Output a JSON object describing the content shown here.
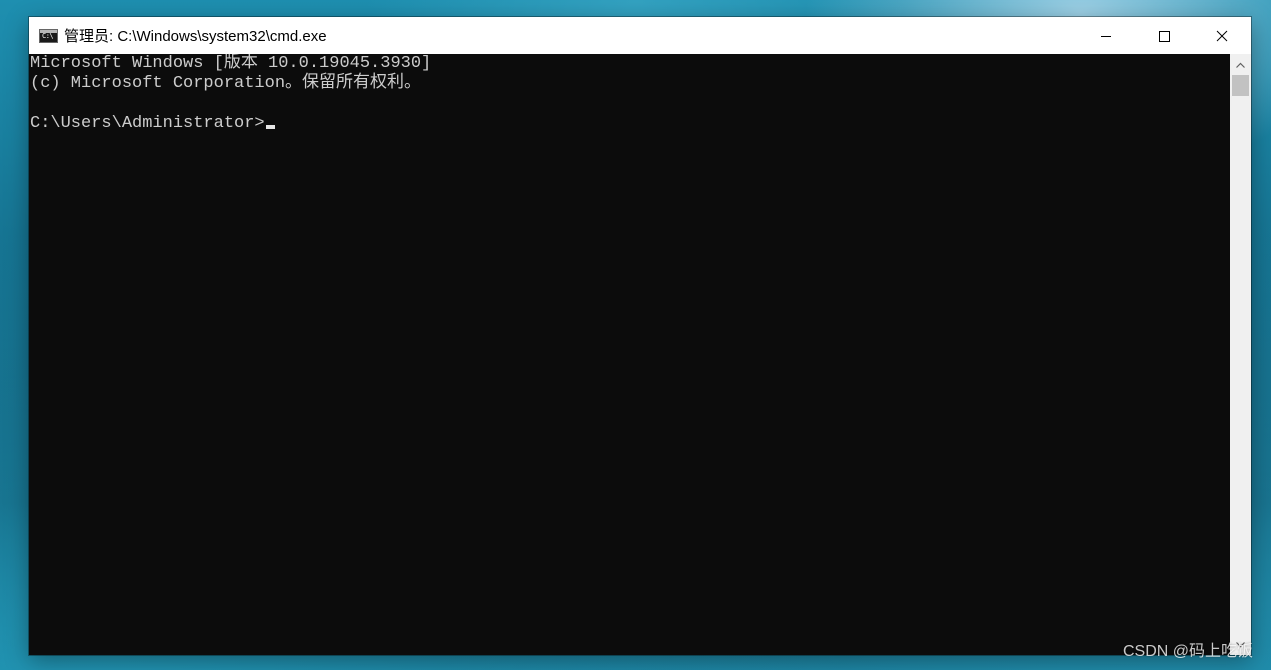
{
  "window": {
    "title": "管理员: C:\\Windows\\system32\\cmd.exe",
    "icon": "cmd-console-icon",
    "caption_buttons": [
      "minimize-icon",
      "maximize-icon",
      "close-icon"
    ]
  },
  "console": {
    "lines": [
      "Microsoft Windows [版本 10.0.19045.3930]",
      "(c) Microsoft Corporation。保留所有权利。",
      "",
      "C:\\Users\\Administrator>"
    ],
    "background_color": "#0c0c0c",
    "text_color": "#cccccc"
  },
  "desktop": {
    "watermark": "CSDN @码上吃饭"
  }
}
